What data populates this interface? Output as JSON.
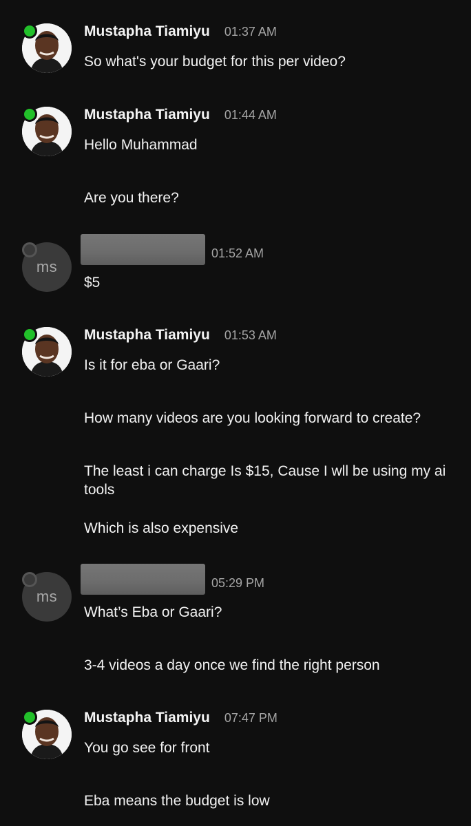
{
  "groups": [
    {
      "sender": "Mustapha Tiamiyu",
      "time": "01:37 AM",
      "avatar": "photo",
      "lines": [
        "So what's your budget for this per video?"
      ]
    },
    {
      "sender": "Mustapha Tiamiyu",
      "time": "01:44 AM",
      "avatar": "photo",
      "lines": [
        "Hello Muhammad",
        "Are you there?"
      ]
    },
    {
      "sender": "",
      "time": "01:52 AM",
      "avatar": "initials",
      "initials": "ms",
      "lines": [
        "$5"
      ]
    },
    {
      "sender": "Mustapha Tiamiyu",
      "time": "01:53 AM",
      "avatar": "photo",
      "lines": [
        "Is it for eba or Gaari?",
        "How many videos are you looking forward to create?",
        "The least i can charge Is $15, Cause I wll be using my ai tools",
        "Which is also expensive"
      ]
    },
    {
      "sender": "",
      "time": "05:29 PM",
      "avatar": "initials",
      "initials": "ms",
      "lines": [
        "What’s Eba or Gaari?",
        "3-4 videos a day once we find the right person"
      ]
    },
    {
      "sender": "Mustapha Tiamiyu",
      "time": "07:47 PM",
      "avatar": "photo",
      "lines": [
        "You go see for front",
        "Eba means the budget is low"
      ]
    }
  ],
  "colors": {
    "background": "#0f0f0f",
    "online": "#22c02a",
    "timestamp": "#a5a5a5",
    "text": "#f2f2f2"
  }
}
